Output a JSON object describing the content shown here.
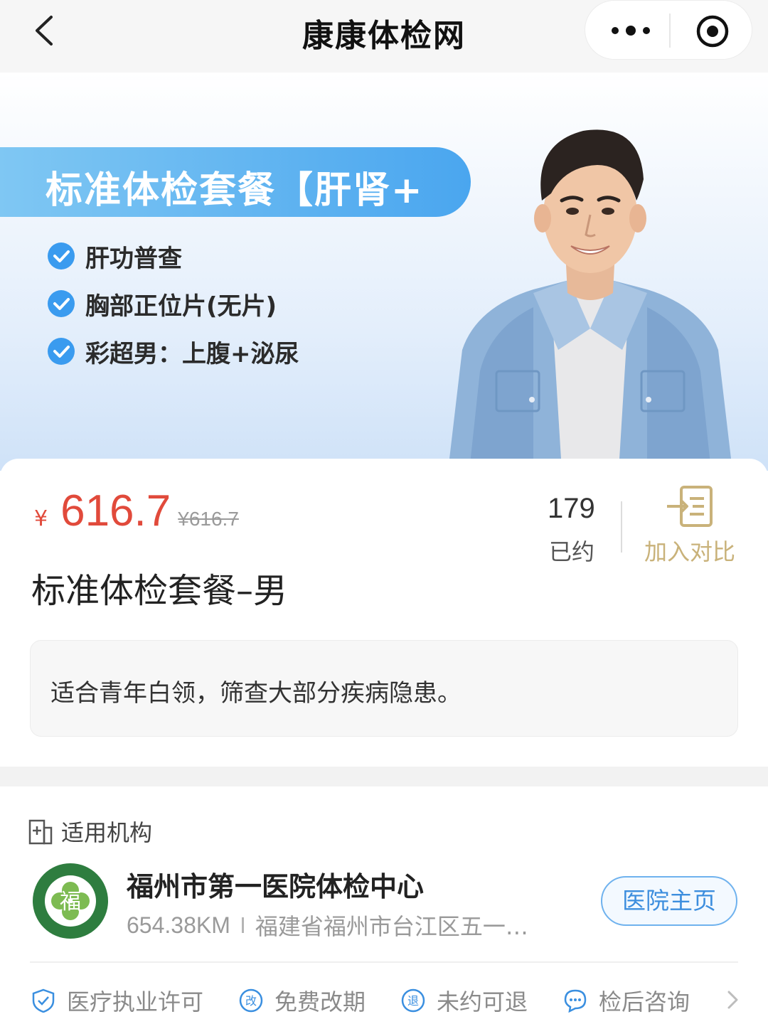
{
  "navbar": {
    "title": "康康体检网"
  },
  "banner": {
    "headline": "标准体检套餐【肝肾+",
    "features": [
      "肝功普查",
      "胸部正位片(无片)",
      "彩超男：上腹+泌尿"
    ]
  },
  "package": {
    "currency": "¥",
    "price": "616.7",
    "original_price": "¥616.7",
    "booked_count": "179",
    "booked_label": "已约",
    "compare_label": "加入对比",
    "name": "标准体检套餐–男",
    "description": "适合青年白领，筛查大部分疾病隐患。"
  },
  "institutions": {
    "heading": "适用机构",
    "hospital": {
      "name": "福州市第一医院体检中心",
      "distance": "654.38KM",
      "address": "福建省福州市台江区五一…",
      "home_button": "医院主页",
      "logo_char": "福"
    },
    "tags": [
      {
        "label": "医疗执业许可",
        "icon": "shield-check-icon"
      },
      {
        "label": "免费改期",
        "icon": "reschedule-icon",
        "glyph": "改"
      },
      {
        "label": "未约可退",
        "icon": "refund-icon",
        "glyph": "退"
      },
      {
        "label": "检后咨询",
        "icon": "chat-icon"
      }
    ]
  },
  "colors": {
    "price": "#e14a3b",
    "accent_blue": "#4aa6ef",
    "compare_gold": "#c9b27a",
    "logo_green": "#2e7d3f"
  }
}
